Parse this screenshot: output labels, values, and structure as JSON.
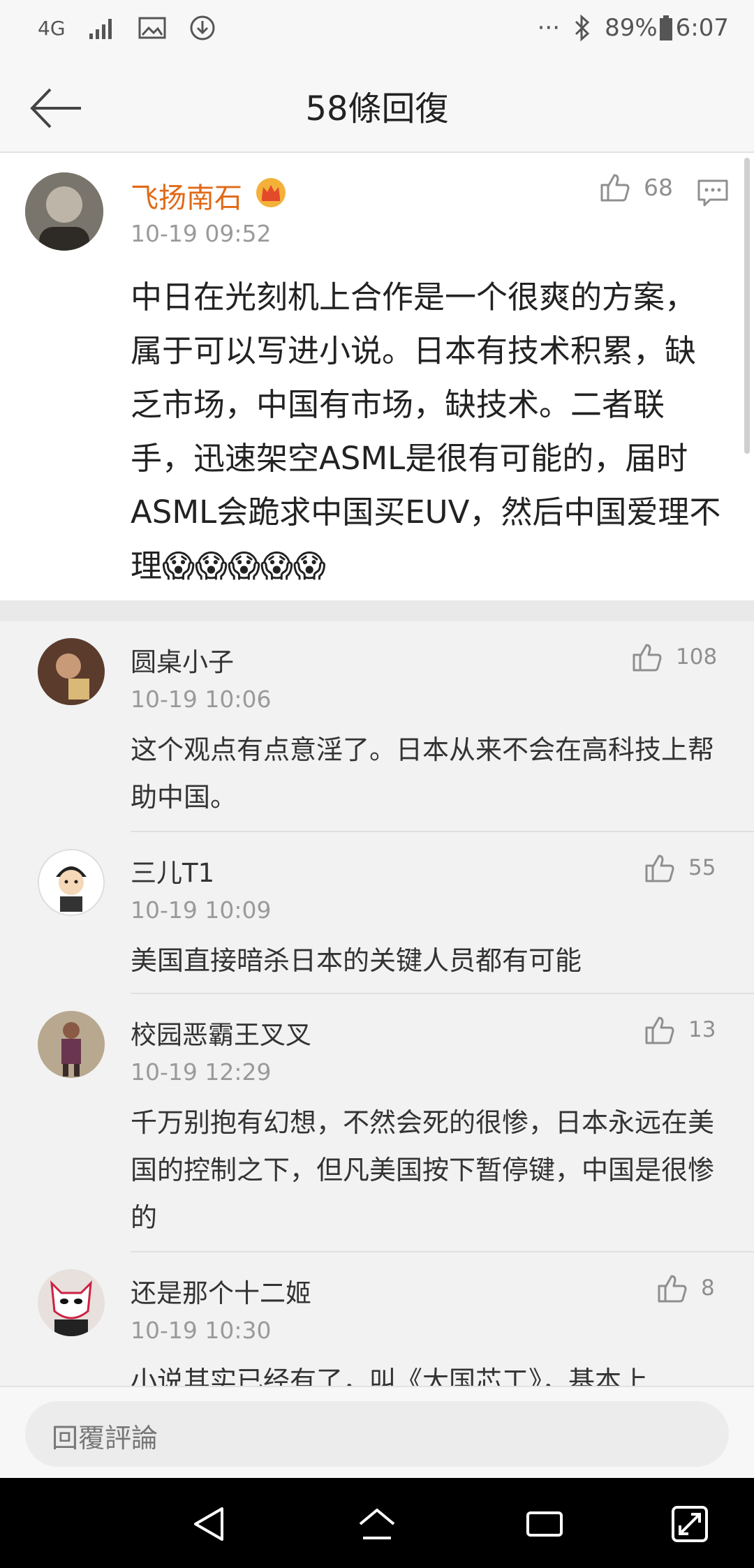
{
  "status_bar": {
    "network": "4G",
    "battery": "89%",
    "time": "6:07",
    "more": "···"
  },
  "header": {
    "title": "58條回復",
    "back_icon": "arrow-left-icon"
  },
  "main_post": {
    "author": "飞扬南石",
    "badge_icon": "crown-icon",
    "time": "10-19 09:52",
    "likes": "68",
    "content": "中日在光刻机上合作是一个很爽的方案，属于可以写进小说。日本有技术积累，缺乏市场，中国有市场，缺技术。二者联手，迅速架空ASML是很有可能的，届时ASML会跪求中国买EUV，然后中国爱理不理😱😱😱😱😱"
  },
  "replies": [
    {
      "name": "圆桌小子",
      "time": "10-19 10:06",
      "likes": "108",
      "text": "这个观点有点意淫了。日本从来不会在高科技上帮助中国。"
    },
    {
      "name": "三儿T1",
      "time": "10-19 10:09",
      "likes": "55",
      "text": "美国直接暗杀日本的关键人员都有可能"
    },
    {
      "name": "校园恶霸王叉叉",
      "time": "10-19 12:29",
      "likes": "13",
      "text": "千万别抱有幻想，不然会死的很惨，日本永远在美国的控制之下，但凡美国按下暂停键，中国是很惨的"
    },
    {
      "name": "还是那个十二姬",
      "time": "10-19 10:30",
      "likes": "8",
      "text": "小说其实已经有了，叫《大国芯工》，基本上"
    }
  ],
  "reply_input": {
    "placeholder": "回覆評論"
  },
  "colors": {
    "author_orange": "#e06a18",
    "meta_gray": "#9a9a9a"
  }
}
